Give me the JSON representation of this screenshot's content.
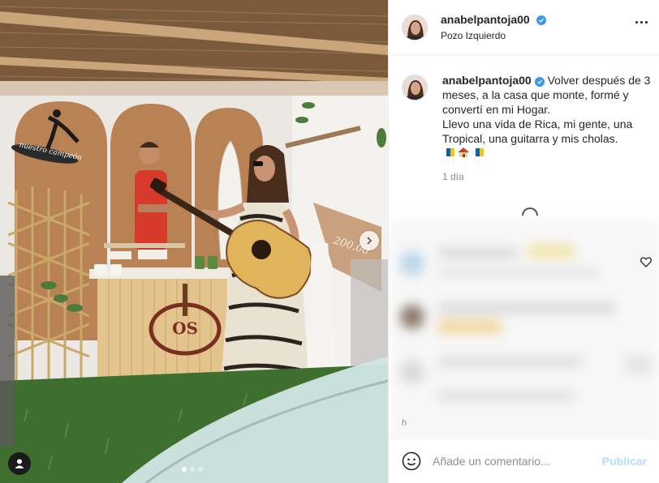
{
  "post": {
    "username": "anabelpantoja00",
    "location": "Pozo Izquierdo",
    "caption": "Volver después de 3 meses, a la casa que monte, formé y convertí en mi Hogar.\nLlevo una vida de Rica, mi gente, una Tropical, una guitarra y mis cholas.",
    "time": "1 día",
    "image": {
      "surf_sign_text": "nuestro campeón",
      "logo_text": "OS",
      "price_tag": "200.00"
    },
    "carousel": {
      "count": 3,
      "active": 0
    }
  },
  "icons": {
    "verified": "verified-badge-icon",
    "more": "more-options-icon",
    "next": "chevron-right-icon",
    "tag": "user-tag-icon",
    "emoji": "emoji-smile-icon",
    "like": "heart-icon",
    "caption_emojis": [
      "canary-flag-emoji",
      "house-emoji",
      "canary-flag-emoji"
    ]
  },
  "comment_box": {
    "placeholder": "Añade un comentario...",
    "publish_label": "Publicar"
  },
  "comments_partial": {
    "letter": "h"
  },
  "colors": {
    "verified": "#3897f0",
    "publish_disabled": "#b2dffc",
    "muted": "#8e8e8e",
    "text": "#262626"
  }
}
